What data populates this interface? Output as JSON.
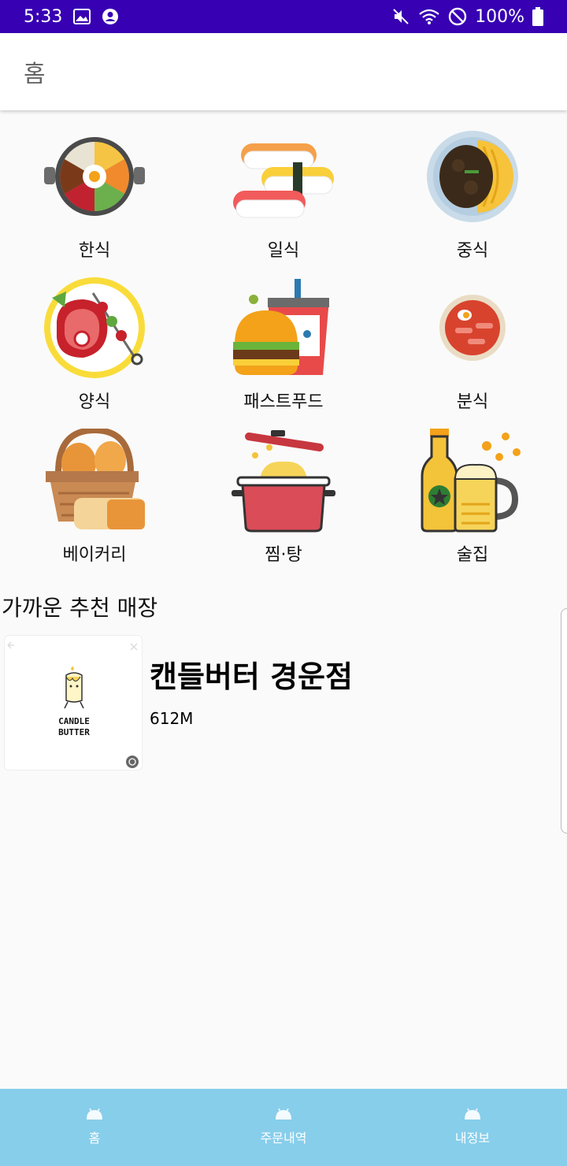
{
  "status_bar": {
    "time": "5:33",
    "battery": "100%"
  },
  "app_bar": {
    "title": "홈"
  },
  "categories": [
    {
      "label": "한식",
      "icon": "bibimbap-icon"
    },
    {
      "label": "일식",
      "icon": "sushi-icon"
    },
    {
      "label": "중식",
      "icon": "jajangmyeon-icon"
    },
    {
      "label": "양식",
      "icon": "steak-icon"
    },
    {
      "label": "패스트푸드",
      "icon": "burger-icon"
    },
    {
      "label": "분식",
      "icon": "tteokbokki-icon"
    },
    {
      "label": "베이커리",
      "icon": "bread-basket-icon"
    },
    {
      "label": "찜·탕",
      "icon": "pot-icon"
    },
    {
      "label": "술집",
      "icon": "beer-icon"
    }
  ],
  "section": {
    "title": "가까운 추천 매장"
  },
  "store": {
    "name": "캔들버터 경운점",
    "distance": "612M",
    "logo_text_1": "CANDLE",
    "logo_text_2": "BUTTER"
  },
  "bottom_nav": [
    {
      "label": "홈"
    },
    {
      "label": "주문내역"
    },
    {
      "label": "내정보"
    }
  ],
  "colors": {
    "status_bar": "#3700b3",
    "bottom_nav": "#87ceeb"
  }
}
